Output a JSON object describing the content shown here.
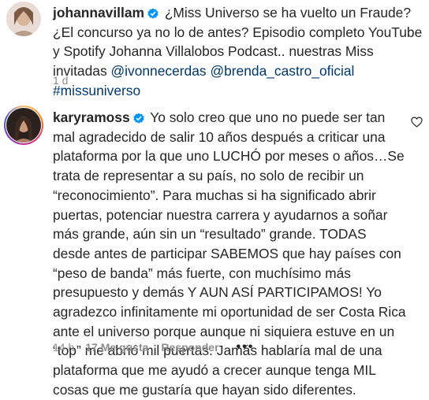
{
  "comments": [
    {
      "username": "johannavillam",
      "text": "¿Miss Universo se ha vuelto un Fraude? ¿El concurso ya no lo de antes? Episodio completo YouTube y Spotify Johanna Villalobos Podcast.. nuestras Miss invitadas",
      "mentions": [
        "@ivonnecerdas",
        "@brenda_castro_oficial",
        "#missuniverso"
      ],
      "time": "1 d"
    },
    {
      "username": "karyramoss",
      "text": "Yo solo creo que uno no puede ser tan mal agradecido de salir 10 años después a criticar una plataforma por la que uno LUCHÓ por meses o años…Se trata de representar a su país, no solo de recibir un “reconocimiento”. Para muchas si ha significado abrir puertas, potenciar nuestra carrera y ayudarnos a soñar más grande, aún sin un “resultado” grande. TODAS desde antes de participar SABEMOS que hay países con “peso de banda” más fuerte, con muchísimo más presupuesto y demás Y AUN ASÍ PARTICIPAMOS! Yo agradezco infinitamente mi oportunidad de ser Costa Rica ante el universo porque aunque ni siquiera estuve en un “top” me abrió mil puertas. Jamás hablaría mal de una plataforma que me ayudó a crecer aunque tenga MIL cosas que me gustaría que hayan sido diferentes.",
      "time": "14 h",
      "likes": "17 Me gusta",
      "reply_label": "Responder",
      "more": "•••"
    }
  ],
  "colors": {
    "verified": "#0095f6",
    "mention": "#00376b",
    "meta": "#8e8e8e"
  },
  "icons": [
    "verified-badge-icon",
    "heart-icon",
    "more-options-icon"
  ]
}
